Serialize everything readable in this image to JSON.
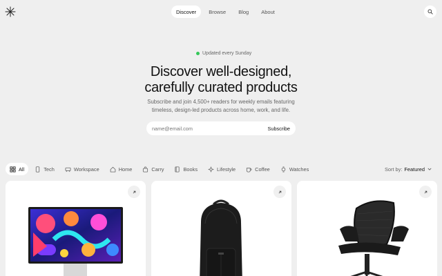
{
  "header": {
    "logo_icon": "asterisk-logo-icon",
    "nav": [
      {
        "label": "Discover",
        "active": true
      },
      {
        "label": "Browse",
        "active": false
      },
      {
        "label": "Blog",
        "active": false
      },
      {
        "label": "About",
        "active": false
      }
    ],
    "search_icon": "search-icon"
  },
  "hero": {
    "badge": "Updated every Sunday",
    "badge_dot_color": "#34c759",
    "title_line1": "Discover well-designed,",
    "title_line2": "carefully curated products",
    "subtitle_line1": "Subscribe and join 4,500+ readers for weekly emails featuring",
    "subtitle_line2": "timeless, design-led products across home, work, and life.",
    "email_placeholder": "name@email.com",
    "subscribe_label": "Subscribe"
  },
  "filters": [
    {
      "label": "All",
      "icon": "grid-icon",
      "active": true
    },
    {
      "label": "Tech",
      "icon": "phone-icon",
      "active": false
    },
    {
      "label": "Workspace",
      "icon": "desk-icon",
      "active": false
    },
    {
      "label": "Home",
      "icon": "home-icon",
      "active": false
    },
    {
      "label": "Carry",
      "icon": "bag-icon",
      "active": false
    },
    {
      "label": "Books",
      "icon": "book-icon",
      "active": false
    },
    {
      "label": "Lifestyle",
      "icon": "sparkle-icon",
      "active": false
    },
    {
      "label": "Coffee",
      "icon": "cup-icon",
      "active": false
    },
    {
      "label": "Watches",
      "icon": "watch-icon",
      "active": false
    }
  ],
  "sort": {
    "label": "Sort by:",
    "value": "Featured"
  },
  "products": [
    {
      "image": "studio-display-monitor"
    },
    {
      "image": "black-leather-backpack"
    },
    {
      "image": "mesh-office-chair"
    }
  ]
}
